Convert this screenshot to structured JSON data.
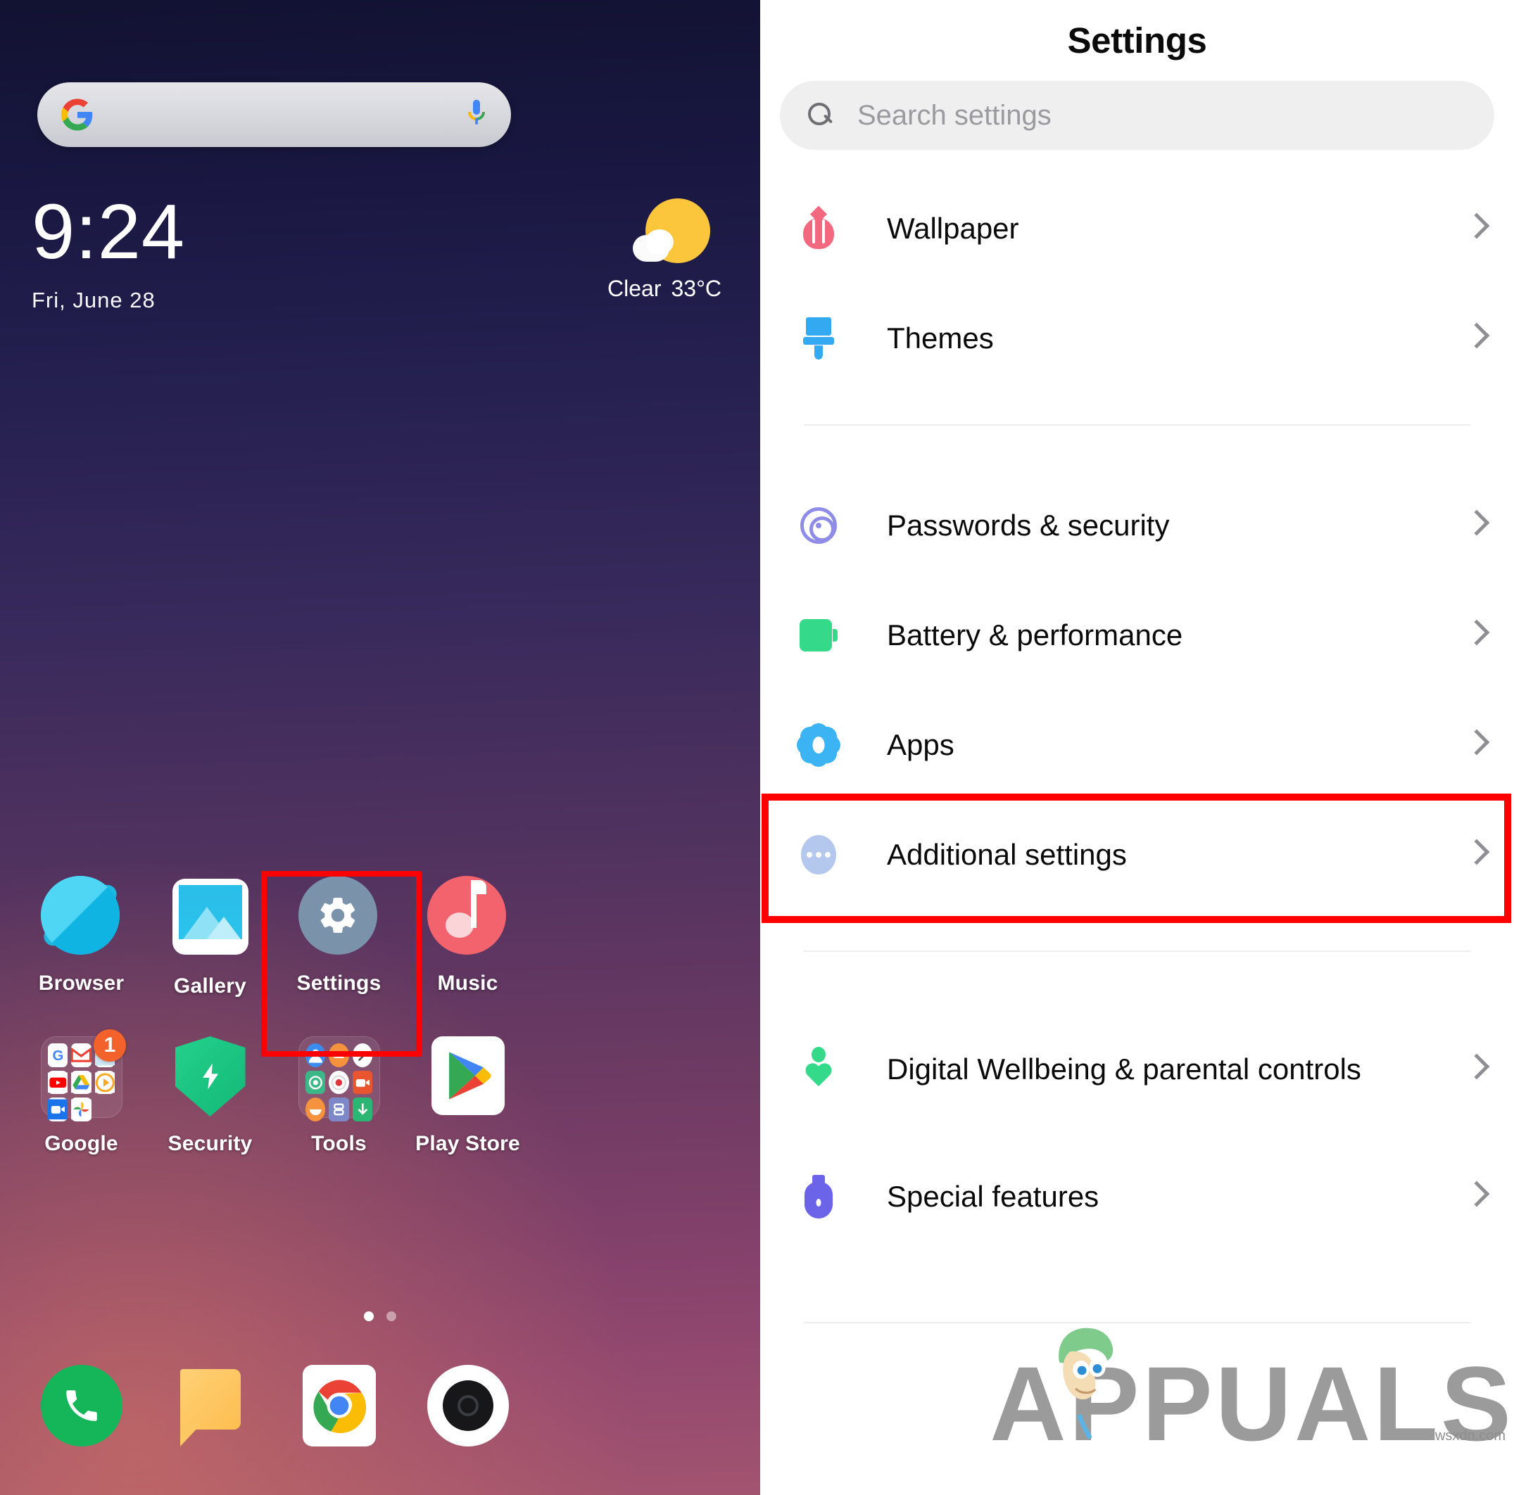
{
  "home": {
    "search_widget": {
      "google_icon": "google-g-logo",
      "mic_icon": "microphone-icon"
    },
    "clock": {
      "time": "9:24",
      "date": "Fri, June 28"
    },
    "weather": {
      "condition": "Clear",
      "temperature": "33°C",
      "icon": "sun-behind-cloud-icon"
    },
    "apps_row1": [
      {
        "label": "Browser",
        "icon": "browser-planet-icon"
      },
      {
        "label": "Gallery",
        "icon": "gallery-photo-icon"
      },
      {
        "label": "Settings",
        "icon": "settings-gear-icon",
        "highlighted": true
      },
      {
        "label": "Music",
        "icon": "music-note-icon"
      }
    ],
    "apps_row2": [
      {
        "label": "Google",
        "icon": "google-folder-icon",
        "badge": "1"
      },
      {
        "label": "Security",
        "icon": "security-shield-icon"
      },
      {
        "label": "Tools",
        "icon": "tools-folder-icon"
      },
      {
        "label": "Play Store",
        "icon": "play-store-icon"
      }
    ],
    "page_indicator": {
      "pages": 2,
      "active": 1
    },
    "dock": [
      {
        "label": "Phone",
        "icon": "phone-handset-icon"
      },
      {
        "label": "Messaging",
        "icon": "message-bubble-icon"
      },
      {
        "label": "Chrome",
        "icon": "chrome-icon"
      },
      {
        "label": "Camera",
        "icon": "camera-lens-icon"
      }
    ],
    "highlight_color": "#ff0000"
  },
  "settings": {
    "title": "Settings",
    "search": {
      "placeholder": "Search settings",
      "icon": "search-icon"
    },
    "group1": [
      {
        "label": "Wallpaper",
        "icon": "tulip-icon",
        "color": "#f2697f"
      },
      {
        "label": "Themes",
        "icon": "paintbrush-icon",
        "color": "#33a9f2"
      }
    ],
    "group2": [
      {
        "label": "Passwords & security",
        "icon": "fingerprint-icon",
        "color": "#8f8ce8"
      },
      {
        "label": "Battery & performance",
        "icon": "battery-icon",
        "color": "#35d98a"
      },
      {
        "label": "Apps",
        "icon": "apps-flower-icon",
        "color": "#3cb4f4",
        "highlighted": true
      },
      {
        "label": "Additional settings",
        "icon": "ellipsis-icon",
        "color": "#b4c7ec"
      }
    ],
    "group3": [
      {
        "label": "Digital Wellbeing & parental controls",
        "icon": "wellbeing-heart-icon",
        "color": "#35d98a"
      },
      {
        "label": "Special features",
        "icon": "vase-icon",
        "color": "#6b63e8"
      }
    ],
    "chevron_icon": "chevron-right-icon",
    "highlight_color": "#ff0000"
  },
  "watermark": {
    "text": "APPUALS",
    "url": "wsxdn.com"
  }
}
